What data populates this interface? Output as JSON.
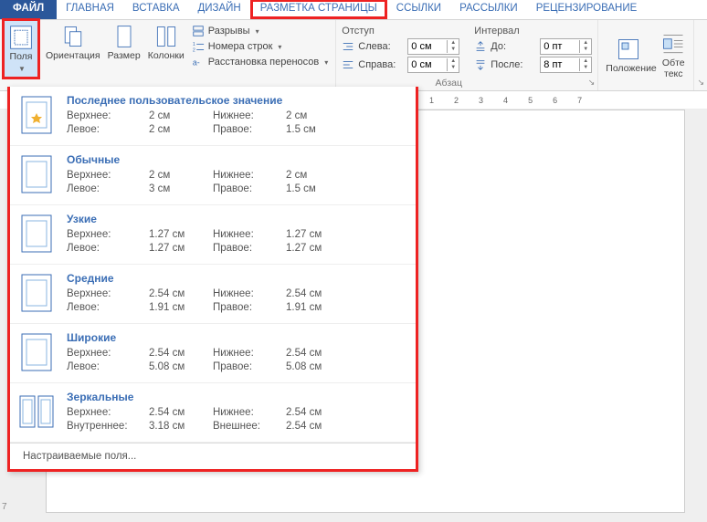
{
  "tabs": {
    "file": "ФАЙЛ",
    "home": "ГЛАВНАЯ",
    "insert": "ВСТАВКА",
    "design": "ДИЗАЙН",
    "layout": "РАЗМЕТКА СТРАНИЦЫ",
    "references": "ССЫЛКИ",
    "mailings": "РАССЫЛКИ",
    "review": "РЕЦЕНЗИРОВАНИЕ"
  },
  "ribbon": {
    "margins": "Поля",
    "orientation": "Ориентация",
    "size": "Размер",
    "columns": "Колонки",
    "breaks": "Разрывы",
    "line_numbers": "Номера строк",
    "hyphenation": "Расстановка переносов",
    "indent_title": "Отступ",
    "left_label": "Слева:",
    "right_label": "Справа:",
    "left_val": "0 см",
    "right_val": "0 см",
    "interval_title": "Интервал",
    "before_label": "До:",
    "after_label": "После:",
    "before_val": "0 пт",
    "after_val": "8 пт",
    "paragraph_group": "Абзац",
    "position": "Положение",
    "wrap": "Обте\nтекс"
  },
  "dropdown": {
    "labels": {
      "top": "Верхнее:",
      "bottom": "Нижнее:",
      "left": "Левое:",
      "right": "Правое:",
      "inner": "Внутреннее:",
      "outer": "Внешнее:"
    },
    "presets": [
      {
        "title": "Последнее пользовательское значение",
        "top": "2 см",
        "bottom": "2 см",
        "left": "2 см",
        "right": "1.5 см",
        "kind": "normal"
      },
      {
        "title": "Обычные",
        "top": "2 см",
        "bottom": "2 см",
        "left": "3 см",
        "right": "1.5 см",
        "kind": "normal"
      },
      {
        "title": "Узкие",
        "top": "1.27 см",
        "bottom": "1.27 см",
        "left": "1.27 см",
        "right": "1.27 см",
        "kind": "normal"
      },
      {
        "title": "Средние",
        "top": "2.54 см",
        "bottom": "2.54 см",
        "left": "1.91 см",
        "right": "1.91 см",
        "kind": "normal"
      },
      {
        "title": "Широкие",
        "top": "2.54 см",
        "bottom": "2.54 см",
        "left": "5.08 см",
        "right": "5.08 см",
        "kind": "normal"
      },
      {
        "title": "Зеркальные",
        "top": "2.54 см",
        "bottom": "2.54 см",
        "left": "3.18 см",
        "right": "2.54 см",
        "kind": "mirror"
      }
    ],
    "custom": "Настраиваемые поля..."
  },
  "ruler": [
    "1",
    "2",
    "3",
    "4",
    "5",
    "6",
    "7"
  ],
  "page_number": "7"
}
